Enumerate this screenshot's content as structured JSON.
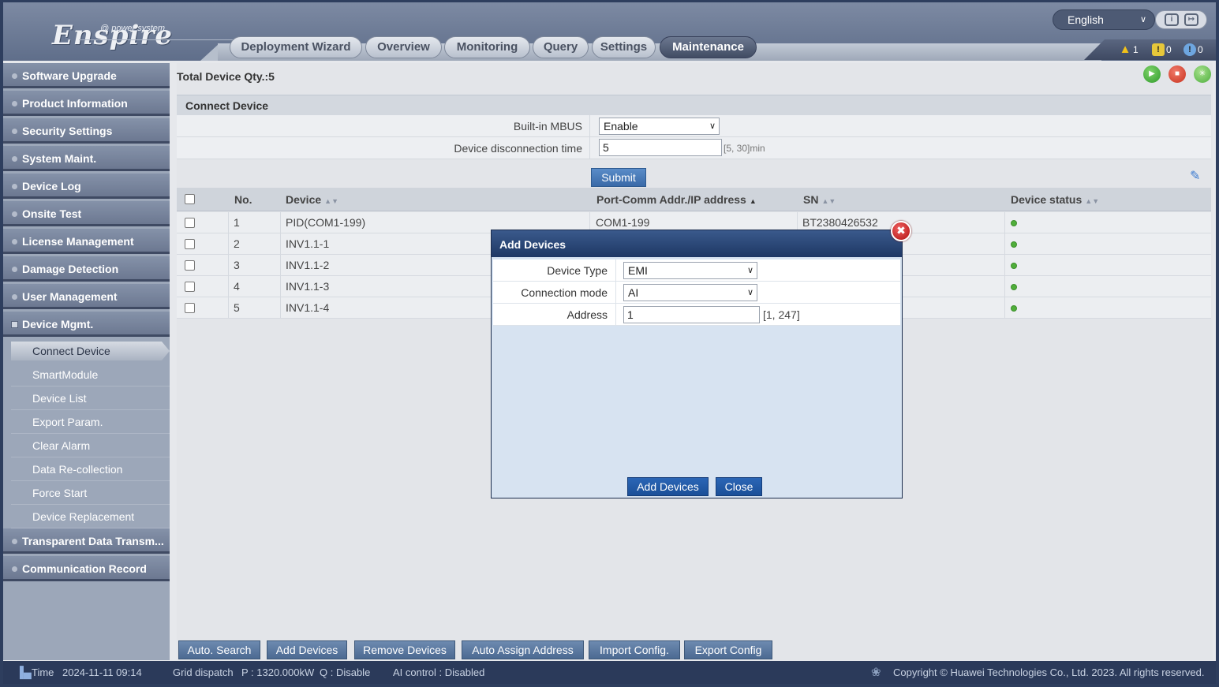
{
  "header": {
    "logo_brand": "Enspire",
    "logo_sub": "@ power system",
    "tabs": [
      {
        "label": "Deployment Wizard"
      },
      {
        "label": "Overview"
      },
      {
        "label": "Monitoring"
      },
      {
        "label": "Query"
      },
      {
        "label": "Settings"
      },
      {
        "label": "Maintenance"
      }
    ],
    "language": "English",
    "alarms": {
      "major": "1",
      "minor": "0",
      "warning": "0"
    }
  },
  "sidebar": {
    "menus": [
      {
        "label": "Software Upgrade"
      },
      {
        "label": "Product Information"
      },
      {
        "label": "Security Settings"
      },
      {
        "label": "System Maint."
      },
      {
        "label": "Device Log"
      },
      {
        "label": "Onsite Test"
      },
      {
        "label": "License Management"
      },
      {
        "label": "Damage Detection"
      },
      {
        "label": "User Management"
      },
      {
        "label": "Device Mgmt."
      },
      {
        "label": "Transparent Data Transm..."
      },
      {
        "label": "Communication Record"
      }
    ],
    "submenu": [
      {
        "label": "Connect Device"
      },
      {
        "label": "SmartModule"
      },
      {
        "label": "Device List"
      },
      {
        "label": "Export Param."
      },
      {
        "label": "Clear Alarm"
      },
      {
        "label": "Data Re-collection"
      },
      {
        "label": "Force Start"
      },
      {
        "label": "Device Replacement"
      }
    ]
  },
  "main": {
    "total_qty": "Total Device Qty.:5",
    "section_title": "Connect Device",
    "form": {
      "mbus_label": "Built-in MBUS",
      "mbus_value": "Enable",
      "disconnect_label": "Device disconnection time",
      "disconnect_value": "5",
      "disconnect_hint": "[5, 30]min"
    },
    "submit_label": "Submit",
    "table": {
      "columns": [
        "No.",
        "Device",
        "Port-Comm Addr./IP address",
        "SN",
        "Device status"
      ],
      "rows": [
        {
          "no": "1",
          "device": "PID(COM1-199)",
          "port": "COM1-199",
          "sn": "BT2380426532"
        },
        {
          "no": "2",
          "device": "INV1.1-1",
          "port": "",
          "sn": ""
        },
        {
          "no": "3",
          "device": "INV1.1-2",
          "port": "",
          "sn": ""
        },
        {
          "no": "4",
          "device": "INV1.1-3",
          "port": "",
          "sn": ""
        },
        {
          "no": "5",
          "device": "INV1.1-4",
          "port": "",
          "sn": ""
        }
      ]
    },
    "bottom_buttons": [
      {
        "label": "Auto. Search"
      },
      {
        "label": "Add Devices"
      },
      {
        "label": "Remove Devices"
      },
      {
        "label": "Auto Assign Address"
      },
      {
        "label": "Import Config."
      },
      {
        "label": "Export Config"
      }
    ]
  },
  "modal": {
    "title": "Add Devices",
    "device_type_label": "Device Type",
    "device_type_value": "EMI",
    "connection_mode_label": "Connection mode",
    "connection_mode_value": "AI",
    "address_label": "Address",
    "address_value": "1",
    "address_hint": "[1, 247]",
    "add_button": "Add Devices",
    "close_button": "Close",
    "close_icon": "✖"
  },
  "status": {
    "time_label": "Time",
    "time_value": "2024-11-11 09:14",
    "grid_dispatch": "Grid dispatch",
    "p_value": "P : 1320.000kW",
    "q_value": "Q : Disable",
    "ai_control": "AI control : Disabled",
    "copyright": "Copyright © Huawei Technologies Co., Ltd. 2023. All rights reserved."
  },
  "colors": {
    "accent": "#2b66b6",
    "status_online": "#4fae3a",
    "header": "#6a7892",
    "statusbar": "#2b3a5a"
  }
}
